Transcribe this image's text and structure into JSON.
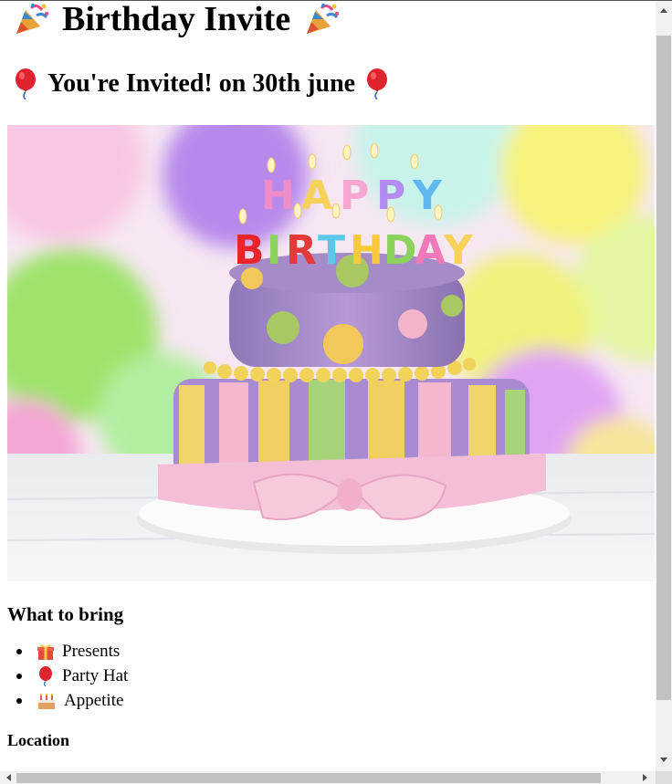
{
  "page": {
    "title": "Birthday Invite",
    "subtitle": "You're Invited! on 30th june"
  },
  "icons": {
    "party_popper": "party-popper-icon",
    "balloon": "balloon-icon",
    "gift": "gift-icon",
    "cake": "birthday-cake-icon"
  },
  "hero_image": {
    "candle_letters_line1": "HAPPY",
    "candle_letters_line2": "BIRTHDAY"
  },
  "bring": {
    "heading": "What to bring",
    "items": [
      {
        "label": "Presents",
        "icon": "gift-icon"
      },
      {
        "label": "Party Hat",
        "icon": "balloon-icon"
      },
      {
        "label": "Appetite",
        "icon": "birthday-cake-icon"
      }
    ]
  },
  "location": {
    "heading": "Location"
  }
}
